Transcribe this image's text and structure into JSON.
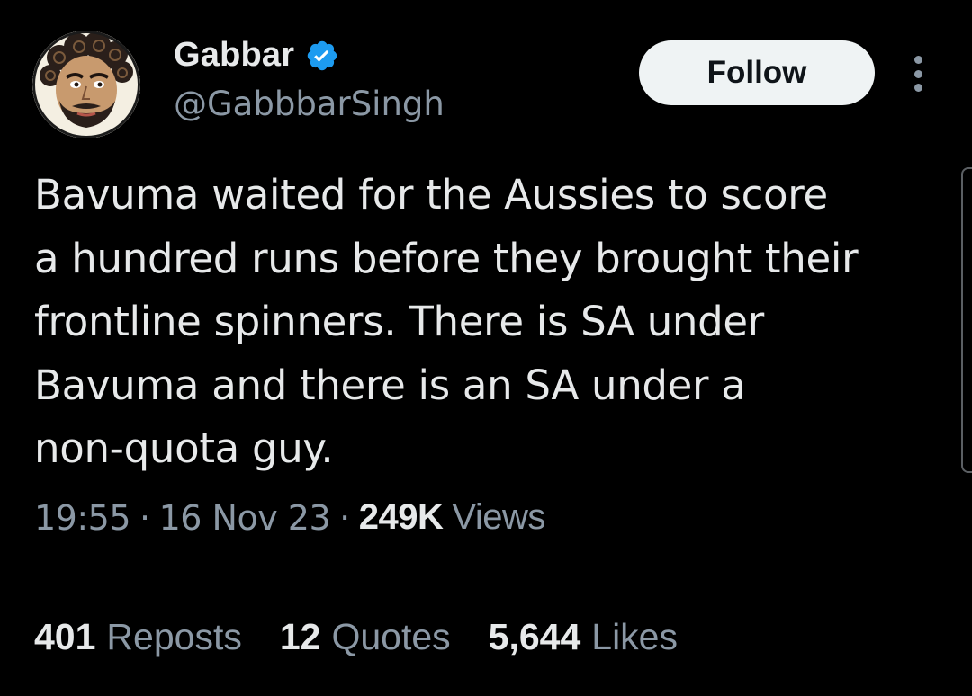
{
  "user": {
    "display_name": "Gabbar",
    "handle": "@GabbbarSingh",
    "verified": true,
    "avatar_icon": "illustrated-face-avatar"
  },
  "actions": {
    "follow_label": "Follow",
    "more_icon": "more-vertical-icon"
  },
  "tweet": {
    "text": "Bavuma waited for the Aussies to score\na hundred runs before they brought their\nfrontline spinners. There is SA under\nBavuma and there is an SA under a\nnon-quota guy."
  },
  "meta": {
    "time": "19:55",
    "separator": "·",
    "date": "16 Nov 23",
    "views_count": "249K",
    "views_label": "Views"
  },
  "stats": {
    "reposts_count": "401",
    "reposts_label": "Reposts",
    "quotes_count": "12",
    "quotes_label": "Quotes",
    "likes_count": "5,644",
    "likes_label": "Likes"
  },
  "colors": {
    "background": "#000000",
    "primary_text": "#e7e9ea",
    "secondary_text": "#8b98a5",
    "verified_blue": "#1d9bf0",
    "follow_bg": "#eff3f4",
    "divider": "#2f3336"
  }
}
